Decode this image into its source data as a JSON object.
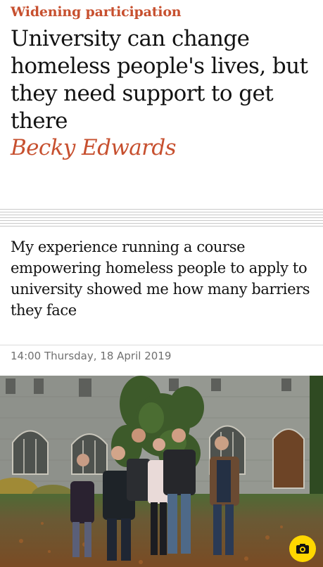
{
  "article": {
    "kicker": "Widening participation",
    "headline": "University can change homeless people's lives, but they need support to get there",
    "byline": "Becky Edwards",
    "standfirst": "My experience running a course empowering homeless people to apply to university showed me how many barriers they face",
    "dateline": "14:00 Thursday, 18 April 2019"
  },
  "photo": {
    "subject": "group-photo",
    "camera_icon": "camera-icon",
    "colors": {
      "accent": "#c7502f",
      "camera_button": "#ffd700"
    }
  }
}
